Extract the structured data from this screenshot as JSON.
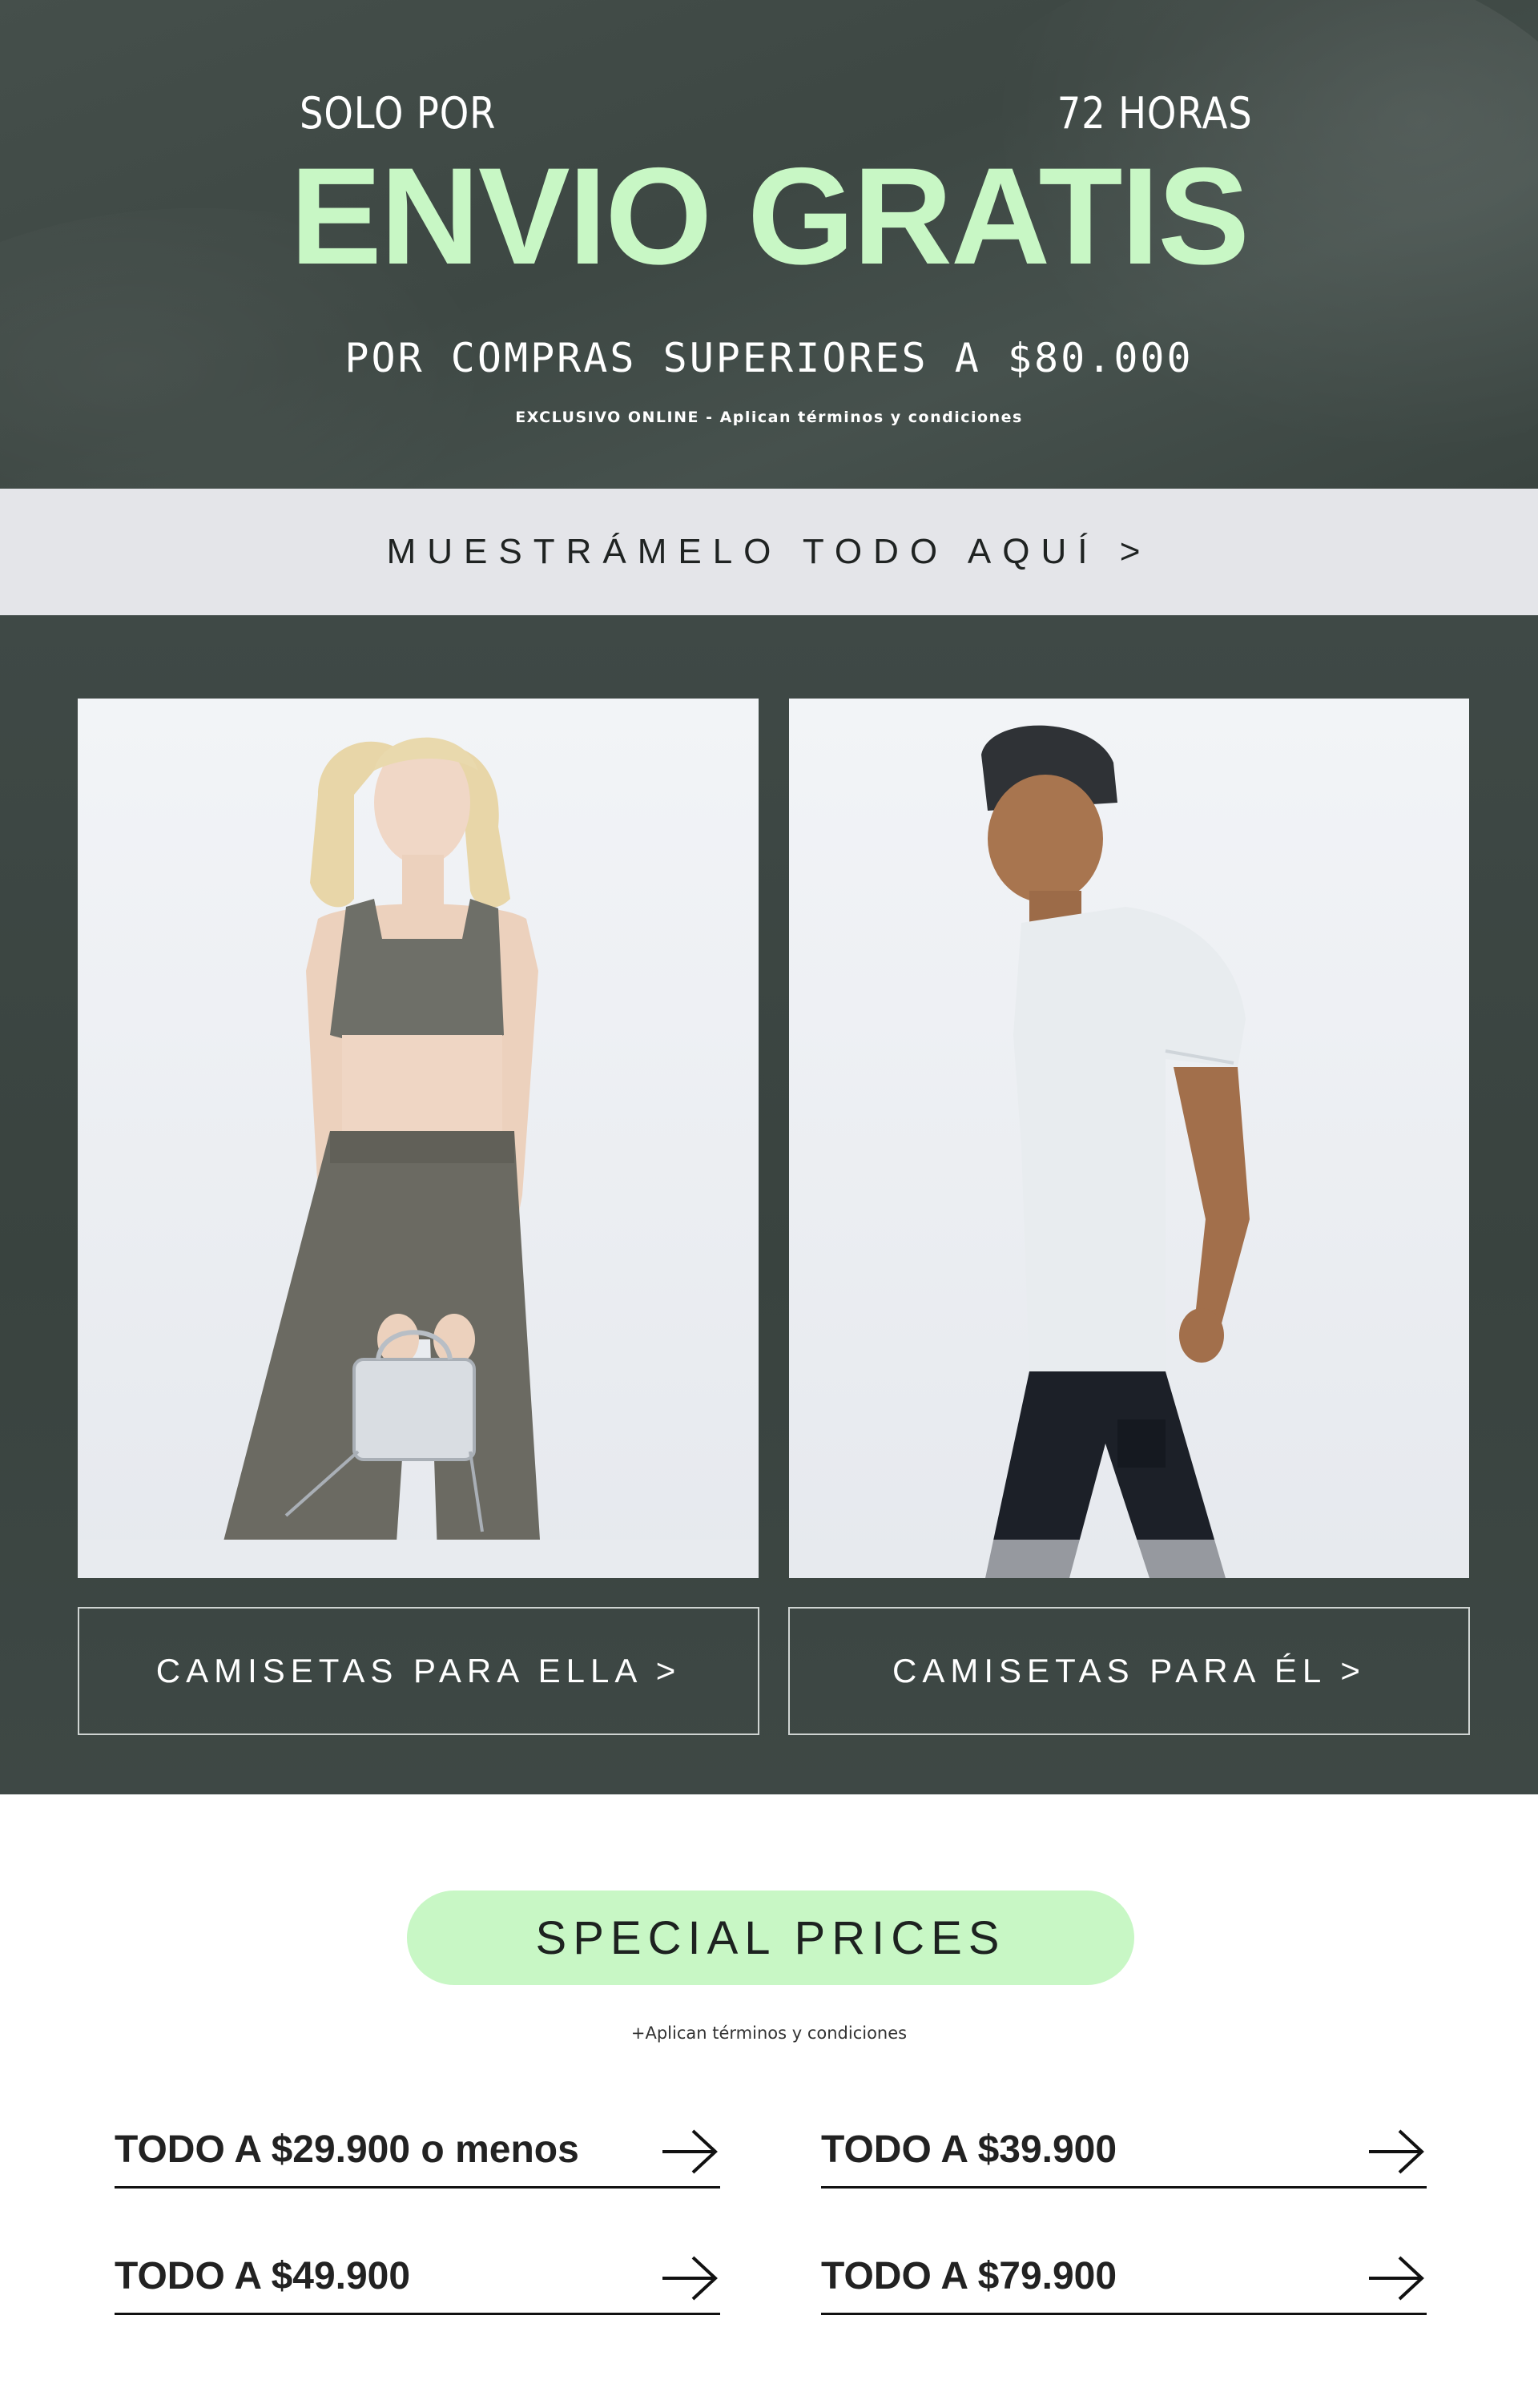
{
  "hero": {
    "solo_por": "SOLO POR",
    "horas": "72 HORAS",
    "headline": "ENVIO GRATIS",
    "subheadline": "POR COMPRAS SUPERIORES A $80.000",
    "disclaimer": "EXCLUSIVO ONLINE - Aplican términos y condiciones"
  },
  "show_all": {
    "label": "MUESTRÁMELO TODO AQUÍ >"
  },
  "products": [
    {
      "cta": "CAMISETAS PARA ELLA >"
    },
    {
      "cta": "CAMISETAS PARA ÉL >"
    }
  ],
  "special": {
    "title": "SPECIAL PRICES",
    "terms": "+Aplican términos y condiciones",
    "links": [
      {
        "label": "TODO A $29.900 o menos"
      },
      {
        "label": "TODO A $39.900"
      },
      {
        "label": "TODO A $49.900"
      },
      {
        "label": "TODO A $79.900"
      }
    ]
  },
  "colors": {
    "accent": "#c8f7c5",
    "hero_bg": "#3f4945",
    "bar_bg": "#e4e5e9",
    "text_dark": "#222222"
  },
  "icons": {
    "arrow": "arrow-right-icon"
  }
}
